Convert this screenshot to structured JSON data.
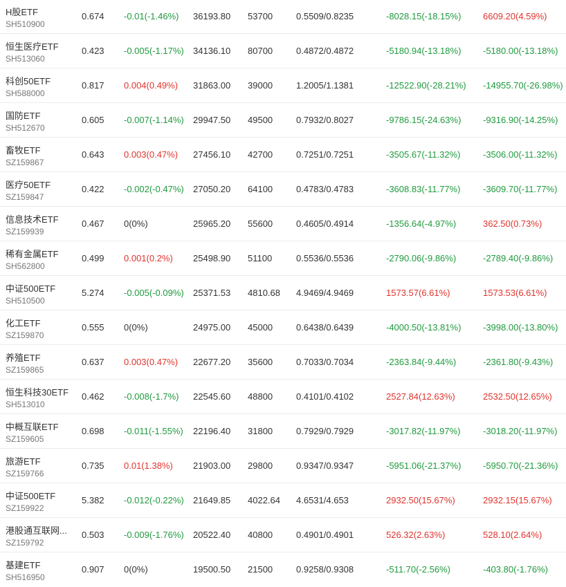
{
  "colors": {
    "up": "#e0332d",
    "down": "#1f9a3e",
    "flat": "#333333"
  },
  "rows": [
    {
      "name": "H股ETF",
      "code": "SH510900",
      "price": "0.674",
      "change": "-0.01(-1.46%)",
      "change_dir": "down",
      "amount": "36193.80",
      "volume": "53700",
      "nav": "0.5509/0.8235",
      "pl1": "-8028.15(-18.15%)",
      "pl1_dir": "down",
      "pl2": "6609.20(4.59%)",
      "pl2_dir": "up"
    },
    {
      "name": "恒生医疗ETF",
      "code": "SH513060",
      "price": "0.423",
      "change": "-0.005(-1.17%)",
      "change_dir": "down",
      "amount": "34136.10",
      "volume": "80700",
      "nav": "0.4872/0.4872",
      "pl1": "-5180.94(-13.18%)",
      "pl1_dir": "down",
      "pl2": "-5180.00(-13.18%)",
      "pl2_dir": "down"
    },
    {
      "name": "科创50ETF",
      "code": "SH588000",
      "price": "0.817",
      "change": "0.004(0.49%)",
      "change_dir": "up",
      "amount": "31863.00",
      "volume": "39000",
      "nav": "1.2005/1.1381",
      "pl1": "-12522.90(-28.21%)",
      "pl1_dir": "down",
      "pl2": "-14955.70(-26.98%)",
      "pl2_dir": "down"
    },
    {
      "name": "国防ETF",
      "code": "SH512670",
      "price": "0.605",
      "change": "-0.007(-1.14%)",
      "change_dir": "down",
      "amount": "29947.50",
      "volume": "49500",
      "nav": "0.7932/0.8027",
      "pl1": "-9786.15(-24.63%)",
      "pl1_dir": "down",
      "pl2": "-9316.90(-14.25%)",
      "pl2_dir": "down"
    },
    {
      "name": "畜牧ETF",
      "code": "SZ159867",
      "price": "0.643",
      "change": "0.003(0.47%)",
      "change_dir": "up",
      "amount": "27456.10",
      "volume": "42700",
      "nav": "0.7251/0.7251",
      "pl1": "-3505.67(-11.32%)",
      "pl1_dir": "down",
      "pl2": "-3506.00(-11.32%)",
      "pl2_dir": "down"
    },
    {
      "name": "医疗50ETF",
      "code": "SZ159847",
      "price": "0.422",
      "change": "-0.002(-0.47%)",
      "change_dir": "down",
      "amount": "27050.20",
      "volume": "64100",
      "nav": "0.4783/0.4783",
      "pl1": "-3608.83(-11.77%)",
      "pl1_dir": "down",
      "pl2": "-3609.70(-11.77%)",
      "pl2_dir": "down"
    },
    {
      "name": "信息技术ETF",
      "code": "SZ159939",
      "price": "0.467",
      "change": "0(0%)",
      "change_dir": "flat",
      "amount": "25965.20",
      "volume": "55600",
      "nav": "0.4605/0.4914",
      "pl1": "-1356.64(-4.97%)",
      "pl1_dir": "down",
      "pl2": "362.50(0.73%)",
      "pl2_dir": "up"
    },
    {
      "name": "稀有金属ETF",
      "code": "SH562800",
      "price": "0.499",
      "change": "0.001(0.2%)",
      "change_dir": "up",
      "amount": "25498.90",
      "volume": "51100",
      "nav": "0.5536/0.5536",
      "pl1": "-2790.06(-9.86%)",
      "pl1_dir": "down",
      "pl2": "-2789.40(-9.86%)",
      "pl2_dir": "down"
    },
    {
      "name": "中证500ETF",
      "code": "SH510500",
      "price": "5.274",
      "change": "-0.005(-0.09%)",
      "change_dir": "down",
      "amount": "25371.53",
      "volume": "4810.68",
      "nav": "4.9469/4.9469",
      "pl1": "1573.57(6.61%)",
      "pl1_dir": "up",
      "pl2": "1573.53(6.61%)",
      "pl2_dir": "up"
    },
    {
      "name": "化工ETF",
      "code": "SZ159870",
      "price": "0.555",
      "change": "0(0%)",
      "change_dir": "flat",
      "amount": "24975.00",
      "volume": "45000",
      "nav": "0.6438/0.6439",
      "pl1": "-4000.50(-13.81%)",
      "pl1_dir": "down",
      "pl2": "-3998.00(-13.80%)",
      "pl2_dir": "down"
    },
    {
      "name": "养殖ETF",
      "code": "SZ159865",
      "price": "0.637",
      "change": "0.003(0.47%)",
      "change_dir": "up",
      "amount": "22677.20",
      "volume": "35600",
      "nav": "0.7033/0.7034",
      "pl1": "-2363.84(-9.44%)",
      "pl1_dir": "down",
      "pl2": "-2361.80(-9.43%)",
      "pl2_dir": "down"
    },
    {
      "name": "恒生科技30ETF",
      "code": "SH513010",
      "price": "0.462",
      "change": "-0.008(-1.7%)",
      "change_dir": "down",
      "amount": "22545.60",
      "volume": "48800",
      "nav": "0.4101/0.4102",
      "pl1": "2527.84(12.63%)",
      "pl1_dir": "up",
      "pl2": "2532.50(12.65%)",
      "pl2_dir": "up"
    },
    {
      "name": "中概互联ETF",
      "code": "SZ159605",
      "price": "0.698",
      "change": "-0.011(-1.55%)",
      "change_dir": "down",
      "amount": "22196.40",
      "volume": "31800",
      "nav": "0.7929/0.7929",
      "pl1": "-3017.82(-11.97%)",
      "pl1_dir": "down",
      "pl2": "-3018.20(-11.97%)",
      "pl2_dir": "down"
    },
    {
      "name": "旅游ETF",
      "code": "SZ159766",
      "price": "0.735",
      "change": "0.01(1.38%)",
      "change_dir": "up",
      "amount": "21903.00",
      "volume": "29800",
      "nav": "0.9347/0.9347",
      "pl1": "-5951.06(-21.37%)",
      "pl1_dir": "down",
      "pl2": "-5950.70(-21.36%)",
      "pl2_dir": "down"
    },
    {
      "name": "中证500ETF",
      "code": "SZ159922",
      "price": "5.382",
      "change": "-0.012(-0.22%)",
      "change_dir": "down",
      "amount": "21649.85",
      "volume": "4022.64",
      "nav": "4.6531/4.653",
      "pl1": "2932.50(15.67%)",
      "pl1_dir": "up",
      "pl2": "2932.15(15.67%)",
      "pl2_dir": "up"
    },
    {
      "name": "港股通互联网...",
      "code": "SZ159792",
      "price": "0.503",
      "change": "-0.009(-1.76%)",
      "change_dir": "down",
      "amount": "20522.40",
      "volume": "40800",
      "nav": "0.4901/0.4901",
      "pl1": "526.32(2.63%)",
      "pl1_dir": "up",
      "pl2": "528.10(2.64%)",
      "pl2_dir": "up"
    },
    {
      "name": "基建ETF",
      "code": "SH516950",
      "price": "0.907",
      "change": "0(0%)",
      "change_dir": "flat",
      "amount": "19500.50",
      "volume": "21500",
      "nav": "0.9258/0.9308",
      "pl1": "-511.70(-2.56%)",
      "pl1_dir": "down",
      "pl2": "-403.80(-1.76%)",
      "pl2_dir": "down"
    }
  ]
}
